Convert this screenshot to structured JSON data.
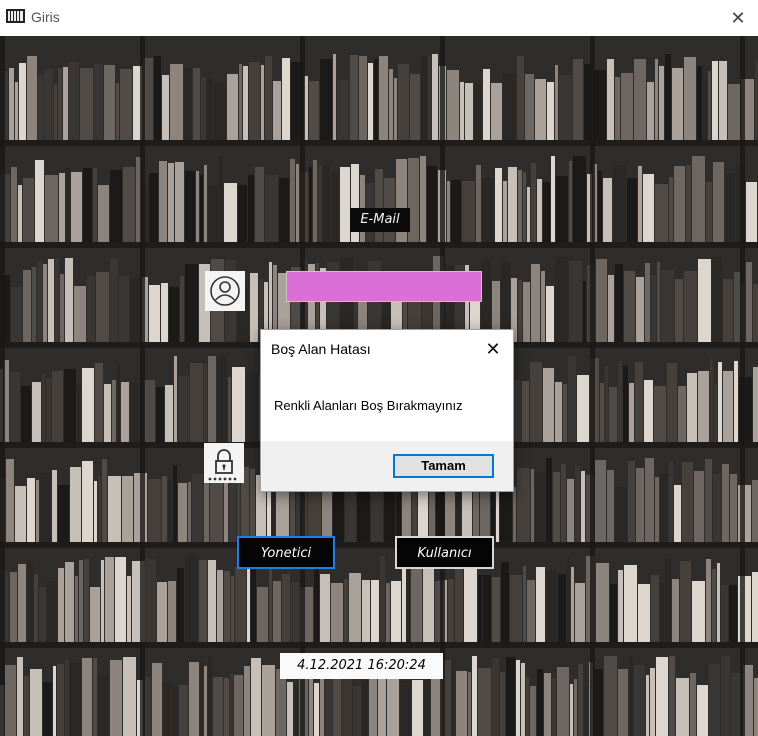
{
  "window": {
    "title": "Giris",
    "icon": "library-books-icon",
    "close_glyph": "✕"
  },
  "form": {
    "email_label": "E-Mail",
    "email_value": "",
    "email_bg": "#da70d6",
    "user_icon": "user-circle-icon",
    "password_icon": "lock-password-icon",
    "admin_button": "Yonetici",
    "user_button": "Kullanıcı",
    "datetime": "4.12.2021 16:20:24"
  },
  "dialog": {
    "title": "Boş Alan Hatası",
    "message": "Renkli Alanları Boş Bırakmayınız",
    "ok_label": "Tamam",
    "close_glyph": "✕"
  },
  "colors": {
    "focus_blue": "#0078d7",
    "admin_border": "#1a7fe6"
  }
}
